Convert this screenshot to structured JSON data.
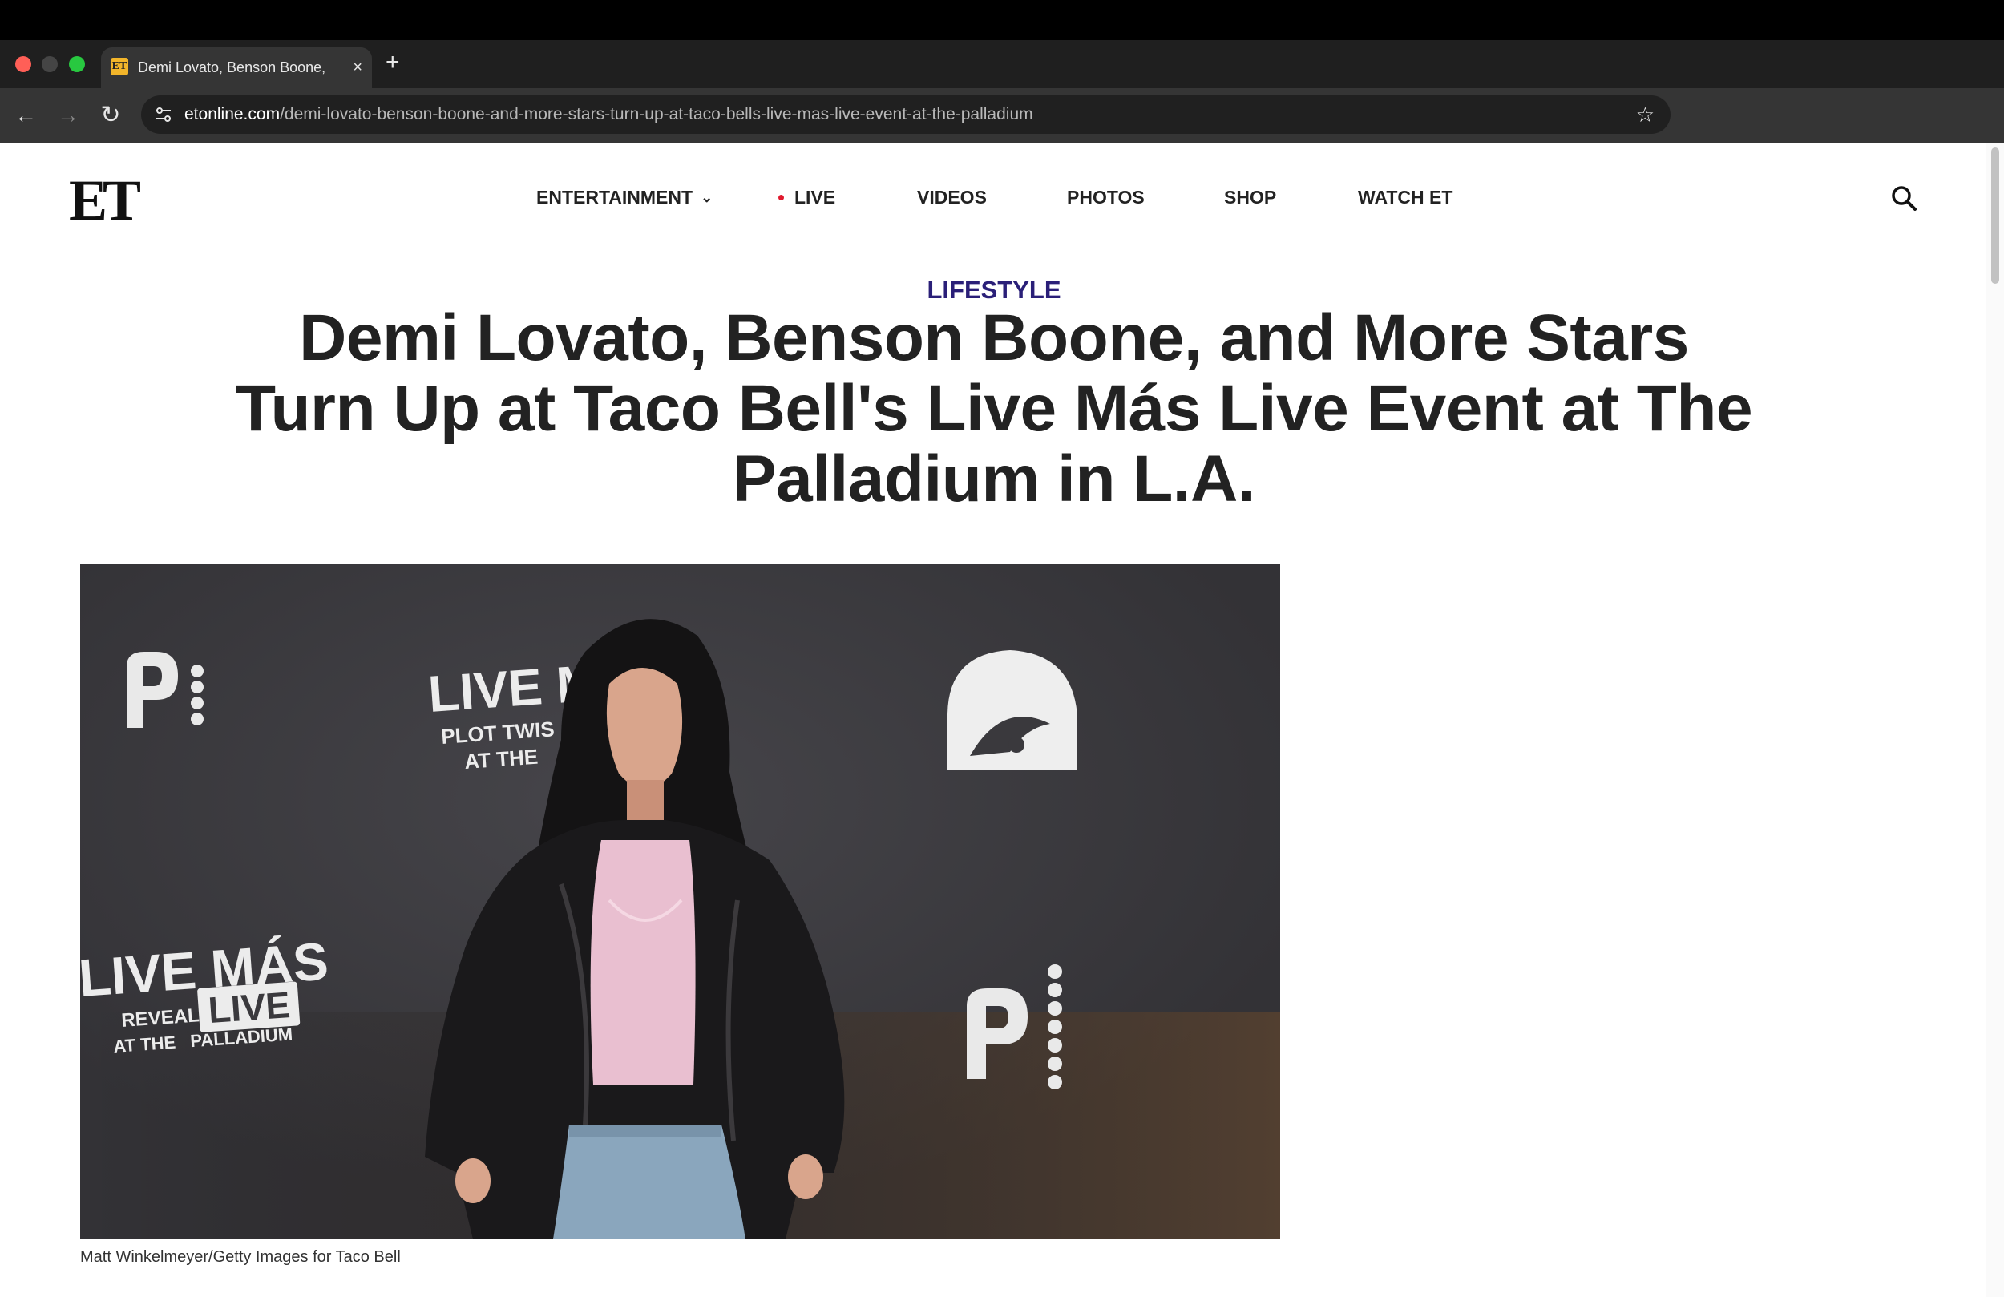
{
  "browser": {
    "tab_favicon": "ET",
    "tab_title": "Demi Lovato, Benson Boone,",
    "tab_close": "×",
    "new_tab": "+",
    "url_host": "etonline.com",
    "url_path": "/demi-lovato-benson-boone-and-more-stars-turn-up-at-taco-bells-live-mas-live-event-at-the-palladium",
    "icons": [
      "back-arrow-icon",
      "forward-arrow-icon",
      "reload-icon",
      "site-settings-icon",
      "bookmark-star-icon"
    ],
    "colors": {
      "window_bar": "#000000",
      "tab_strip": "#1f1f1f",
      "toolbar": "#353535",
      "omnibox": "#202020"
    }
  },
  "site": {
    "logo": "ET",
    "nav": {
      "entertainment": "ENTERTAINMENT",
      "live": "LIVE",
      "videos": "VIDEOS",
      "photos": "PHOTOS",
      "shop": "SHOP",
      "watch_et": "WATCH ET"
    },
    "colors": {
      "kicker": "#2a1f78",
      "live_dot": "#e0192e",
      "text": "#222222"
    }
  },
  "article": {
    "category": "LIFESTYLE",
    "headline": "Demi Lovato, Benson Boone, and More Stars Turn Up at Taco Bell's Live Más Live Event at The Palladium in L.A.",
    "photo": {
      "backdrop_text": {
        "live_title_left": "LIVE M",
        "plot_twist": "PLOT TWIS",
        "at_the": "AT THE",
        "live_mas_left": "LIVE MÁS",
        "reveals": "REVEALS",
        "live_badge": "LIVE",
        "at_the_palladium": "AT THE   PALLADIUM"
      },
      "credit": "Matt Winkelmeyer/Getty Images for Taco Bell"
    }
  }
}
